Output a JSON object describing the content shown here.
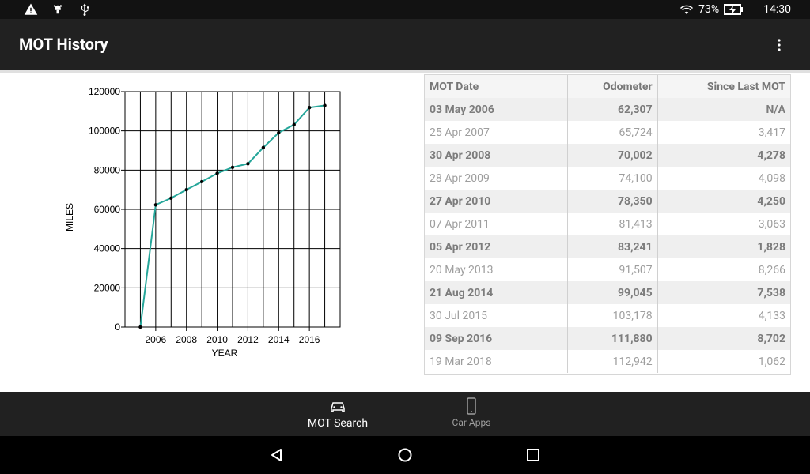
{
  "status_bar": {
    "battery": "73%",
    "time": "14:30",
    "icons": [
      "warning-icon",
      "android-debug-icon",
      "usb-icon",
      "wifi-icon",
      "battery-charging-icon"
    ]
  },
  "app_bar": {
    "title": "MOT History",
    "menu_icon": "more-vert-icon"
  },
  "chart_data": {
    "type": "line",
    "xlabel": "YEAR",
    "ylabel": "MILES",
    "xlim": [
      2004,
      2018
    ],
    "ylim": [
      0,
      120000
    ],
    "xticks": [
      2006,
      2008,
      2010,
      2012,
      2014,
      2016
    ],
    "yticks": [
      0,
      20000,
      40000,
      60000,
      80000,
      100000,
      120000
    ],
    "grid": true,
    "line_color": "#26a69a",
    "points": [
      {
        "x": 2005,
        "y": 0
      },
      {
        "x": 2006,
        "y": 62307
      },
      {
        "x": 2007,
        "y": 65724
      },
      {
        "x": 2008,
        "y": 70002
      },
      {
        "x": 2009,
        "y": 74100
      },
      {
        "x": 2010,
        "y": 78350
      },
      {
        "x": 2011,
        "y": 81413
      },
      {
        "x": 2012,
        "y": 83241
      },
      {
        "x": 2013,
        "y": 91507
      },
      {
        "x": 2014,
        "y": 99045
      },
      {
        "x": 2015,
        "y": 103178
      },
      {
        "x": 2016,
        "y": 111880
      },
      {
        "x": 2017,
        "y": 112942
      }
    ]
  },
  "table": {
    "headers": [
      "MOT Date",
      "Odometer",
      "Since Last MOT"
    ],
    "rows": [
      [
        "03 May 2006",
        "62,307",
        "N/A"
      ],
      [
        "25 Apr 2007",
        "65,724",
        "3,417"
      ],
      [
        "30 Apr 2008",
        "70,002",
        "4,278"
      ],
      [
        "28 Apr 2009",
        "74,100",
        "4,098"
      ],
      [
        "27 Apr 2010",
        "78,350",
        "4,250"
      ],
      [
        "07 Apr 2011",
        "81,413",
        "3,063"
      ],
      [
        "05 Apr 2012",
        "83,241",
        "1,828"
      ],
      [
        "20 May 2013",
        "91,507",
        "8,266"
      ],
      [
        "21 Aug 2014",
        "99,045",
        "7,538"
      ],
      [
        "30 Jul 2015",
        "103,178",
        "4,133"
      ],
      [
        "09 Sep 2016",
        "111,880",
        "8,702"
      ],
      [
        "19 Mar 2018",
        "112,942",
        "1,062"
      ]
    ]
  },
  "bottom_nav": {
    "items": [
      {
        "label": "MOT Search",
        "icon": "car-icon",
        "active": true
      },
      {
        "label": "Car Apps",
        "icon": "phone-icon",
        "active": false
      }
    ]
  },
  "system_nav": [
    "back-icon",
    "home-icon",
    "recents-icon"
  ]
}
